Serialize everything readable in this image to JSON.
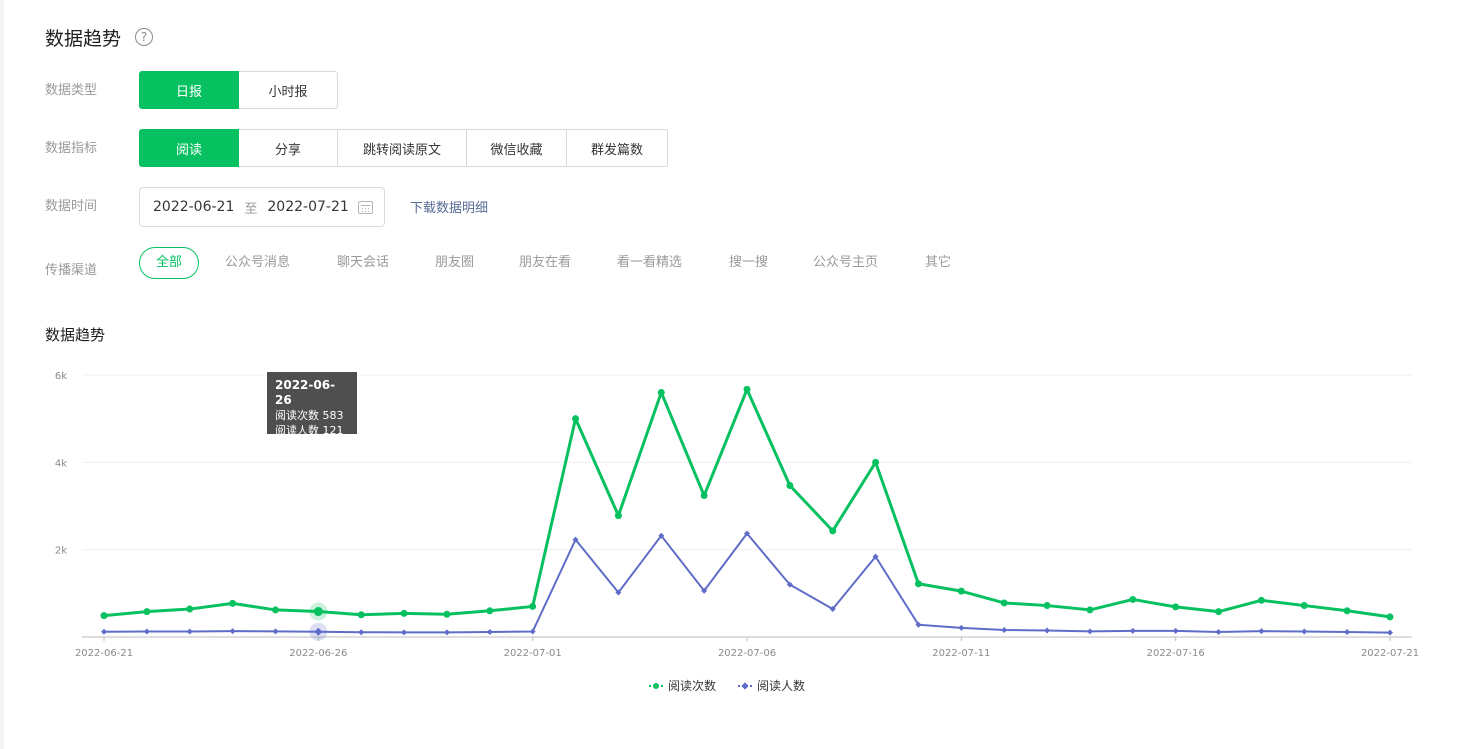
{
  "header": {
    "title": "数据趋势",
    "help_icon": "?"
  },
  "filters": {
    "type_label": "数据类型",
    "type_options": [
      "日报",
      "小时报"
    ],
    "type_selected": "日报",
    "metric_label": "数据指标",
    "metric_options": [
      "阅读",
      "分享",
      "跳转阅读原文",
      "微信收藏",
      "群发篇数"
    ],
    "metric_selected": "阅读",
    "time_label": "数据时间",
    "date_start": "2022-06-21",
    "date_sep": "至",
    "date_end": "2022-07-21",
    "download_label": "下载数据明细",
    "channel_label": "传播渠道",
    "channels": [
      "全部",
      "公众号消息",
      "聊天会话",
      "朋友圈",
      "朋友在看",
      "看一看精选",
      "搜一搜",
      "公众号主页",
      "其它"
    ],
    "channel_selected": "全部"
  },
  "section": {
    "title": "数据趋势"
  },
  "tooltip": {
    "date": "2022-06-26",
    "line1": "阅读次数 583",
    "line2": "阅读人数 121"
  },
  "colors": {
    "accent": "#07c160",
    "series1": "#07c160",
    "series2": "#5f6dc9",
    "link": "#576b95"
  },
  "chart_data": {
    "type": "line",
    "x": [
      "2022-06-21",
      "2022-06-22",
      "2022-06-23",
      "2022-06-24",
      "2022-06-25",
      "2022-06-26",
      "2022-06-27",
      "2022-06-28",
      "2022-06-29",
      "2022-06-30",
      "2022-07-01",
      "2022-07-02",
      "2022-07-03",
      "2022-07-04",
      "2022-07-05",
      "2022-07-06",
      "2022-07-07",
      "2022-07-08",
      "2022-07-09",
      "2022-07-10",
      "2022-07-11",
      "2022-07-12",
      "2022-07-13",
      "2022-07-14",
      "2022-07-15",
      "2022-07-16",
      "2022-07-17",
      "2022-07-18",
      "2022-07-19",
      "2022-07-20",
      "2022-07-21"
    ],
    "x_tick_labels": [
      "2022-06-21",
      "2022-06-26",
      "2022-07-01",
      "2022-07-06",
      "2022-07-11",
      "2022-07-16",
      "2022-07-21"
    ],
    "y_tick_labels": [
      "2k",
      "4k",
      "6k"
    ],
    "y_ticks": [
      2000,
      4000,
      6000
    ],
    "ylim": [
      0,
      6000
    ],
    "series": [
      {
        "name": "阅读次数",
        "values": [
          490,
          580,
          640,
          770,
          620,
          583,
          510,
          540,
          520,
          600,
          700,
          5000,
          2780,
          5600,
          3240,
          5670,
          3470,
          2430,
          4000,
          1220,
          1050,
          780,
          720,
          620,
          860,
          690,
          580,
          840,
          720,
          600,
          460
        ]
      },
      {
        "name": "阅读人数",
        "values": [
          120,
          125,
          125,
          135,
          130,
          121,
          110,
          105,
          105,
          115,
          125,
          2230,
          1020,
          2320,
          1060,
          2370,
          1200,
          640,
          1840,
          280,
          210,
          160,
          150,
          130,
          140,
          140,
          115,
          135,
          125,
          115,
          100
        ]
      }
    ],
    "highlight_index": 5,
    "legend_position": "bottom-center",
    "grid": true
  }
}
